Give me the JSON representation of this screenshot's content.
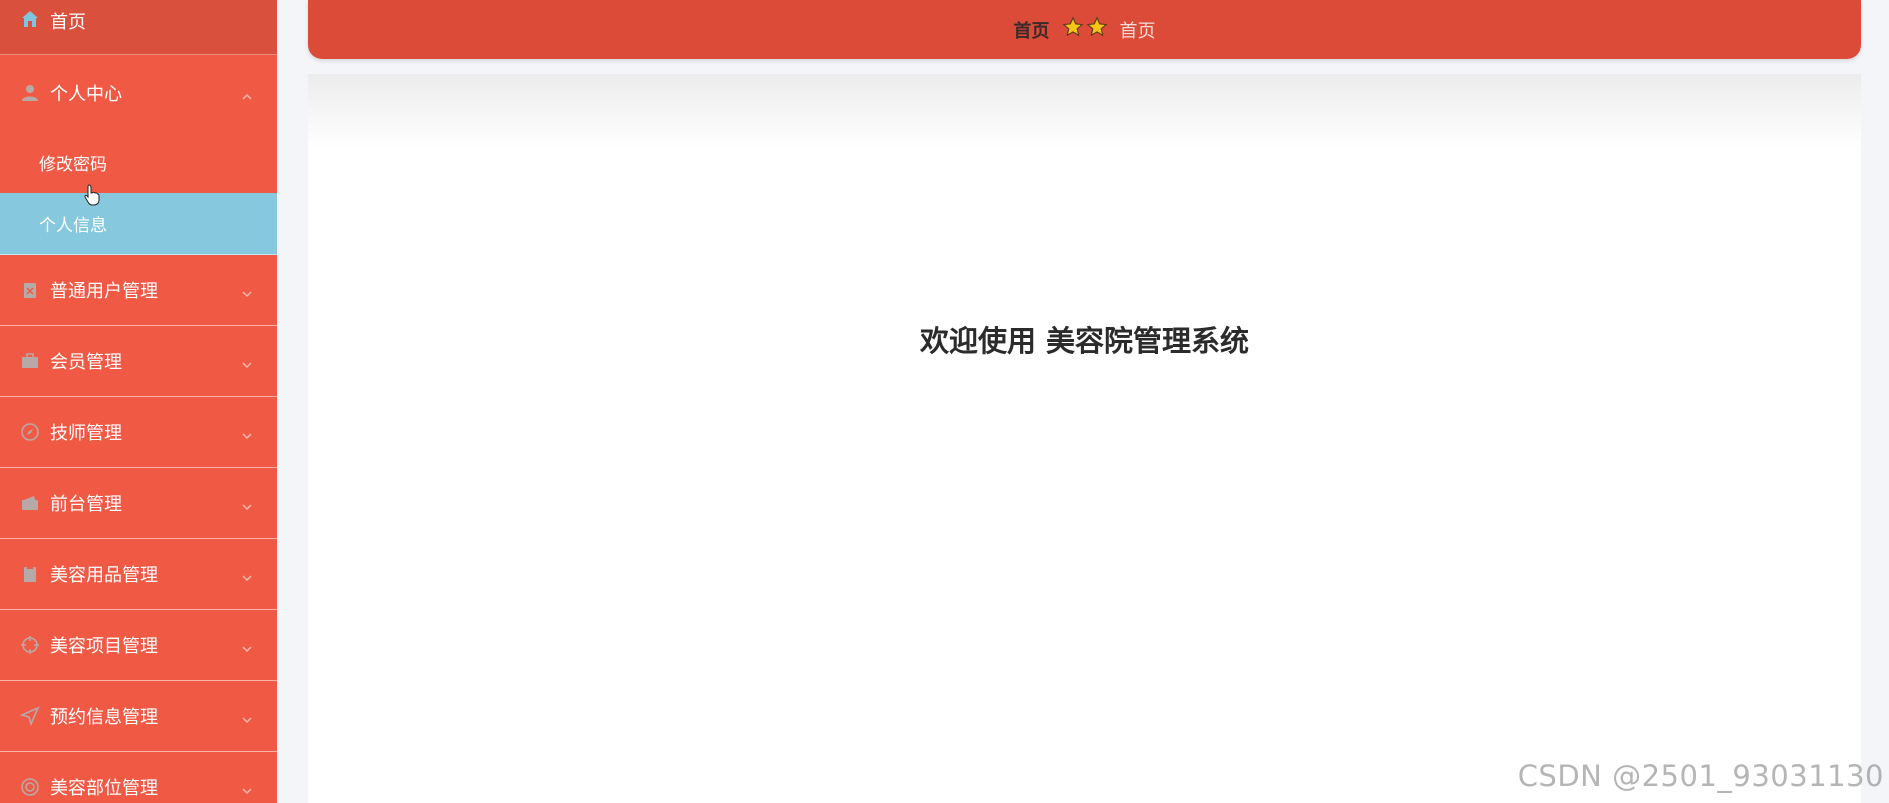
{
  "sidebar": {
    "home": {
      "label": "首页",
      "icon": "home-icon"
    },
    "personal_center": {
      "label": "个人中心",
      "icon": "user-icon",
      "children": [
        {
          "label": "修改密码"
        },
        {
          "label": "个人信息"
        }
      ]
    },
    "items": [
      {
        "label": "普通用户管理",
        "icon": "clipboard-user-icon"
      },
      {
        "label": "会员管理",
        "icon": "briefcase-icon"
      },
      {
        "label": "技师管理",
        "icon": "compass-icon"
      },
      {
        "label": "前台管理",
        "icon": "wallet-icon"
      },
      {
        "label": "美容用品管理",
        "icon": "clipboard-icon"
      },
      {
        "label": "美容项目管理",
        "icon": "target-icon"
      },
      {
        "label": "预约信息管理",
        "icon": "navigation-icon"
      },
      {
        "label": "美容部位管理",
        "icon": "circle-target-icon"
      }
    ]
  },
  "breadcrumb": {
    "first": "首页",
    "current": "首页"
  },
  "main": {
    "welcome": "欢迎使用 美容院管理系统"
  },
  "watermark": "CSDN @2501_93031130",
  "colors": {
    "sidebar_bg": "#f05a45",
    "sidebar_active": "#86c8dd",
    "topbar_bg": "#db4b38",
    "star": "#f5c518"
  }
}
